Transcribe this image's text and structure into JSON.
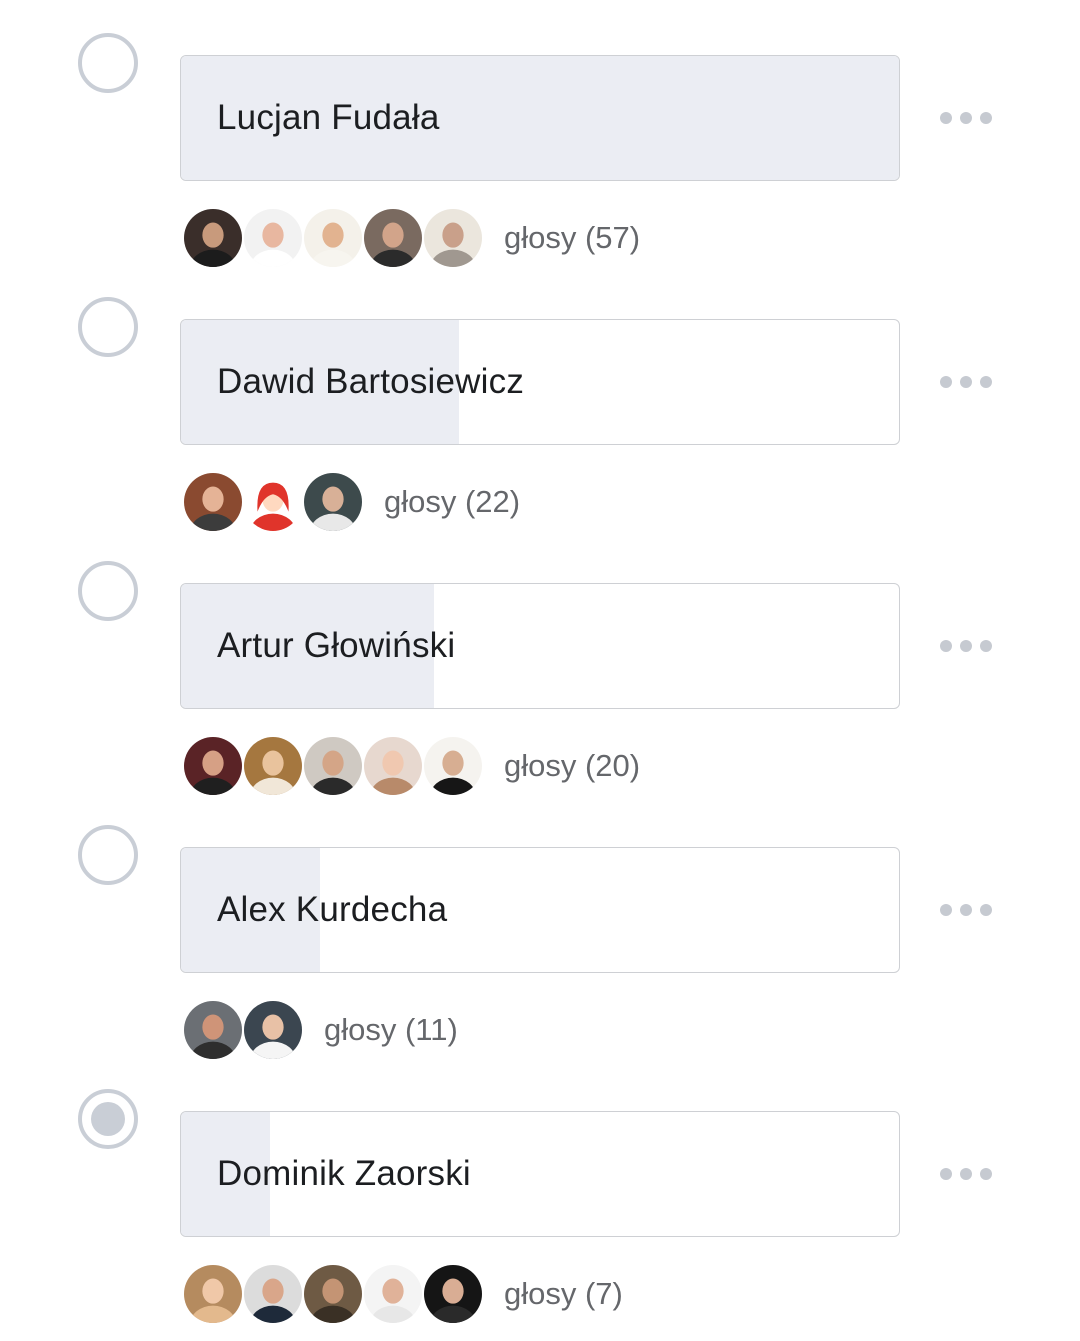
{
  "poll": {
    "options": [
      {
        "name": "Lucjan Fudała",
        "votes_label": "głosy (57)",
        "vote_share": 1.0,
        "selected": false,
        "voter_avatars": [
          {
            "icon": "profile-photo",
            "bg": "#3a2e2a",
            "face": "#c89a7c",
            "shirt": "#1c1c1c"
          },
          {
            "icon": "profile-photo",
            "bg": "#f2f2f2",
            "face": "#e8b7a0",
            "shirt": "#ffffff"
          },
          {
            "icon": "profile-photo",
            "bg": "#f4f1ea",
            "face": "#e2b390",
            "shirt": "#f7f5ef"
          },
          {
            "icon": "profile-photo",
            "bg": "#7a6a60",
            "face": "#d2a48a",
            "shirt": "#2b2b2b"
          },
          {
            "icon": "profile-photo",
            "bg": "#ebe6dd",
            "face": "#c9a08a",
            "shirt": "#a09890"
          }
        ]
      },
      {
        "name": "Dawid Bartosiewicz",
        "votes_label": "głosy (22)",
        "vote_share": 0.386,
        "selected": false,
        "voter_avatars": [
          {
            "icon": "profile-photo",
            "bg": "#8a4a30",
            "face": "#e5b396",
            "shirt": "#3c3c3c"
          },
          {
            "icon": "cartoon-avatar",
            "bg": "#ffffff",
            "face": "#ffd9c0",
            "shirt": "#e0342b"
          },
          {
            "icon": "profile-photo",
            "bg": "#3d4a4c",
            "face": "#d8b097",
            "shirt": "#e8e8e8"
          }
        ]
      },
      {
        "name": "Artur Głowiński",
        "votes_label": "głosy (20)",
        "vote_share": 0.351,
        "selected": false,
        "voter_avatars": [
          {
            "icon": "profile-photo",
            "bg": "#5a2326",
            "face": "#d6a085",
            "shirt": "#1f1f1f"
          },
          {
            "icon": "profile-photo",
            "bg": "#a5773f",
            "face": "#e9c39d",
            "shirt": "#f1e7d8"
          },
          {
            "icon": "profile-photo",
            "bg": "#cfc9c2",
            "face": "#d4a587",
            "shirt": "#2a2a2a"
          },
          {
            "icon": "profile-photo",
            "bg": "#e7d8cf",
            "face": "#f0c8b0",
            "shirt": "#b88a6a"
          },
          {
            "icon": "profile-photo",
            "bg": "#f5f3ef",
            "face": "#d7ae92",
            "shirt": "#161616"
          }
        ]
      },
      {
        "name": "Alex Kurdecha",
        "votes_label": "głosy (11)",
        "vote_share": 0.193,
        "selected": false,
        "voter_avatars": [
          {
            "icon": "profile-photo",
            "bg": "#6b6f74",
            "face": "#cf9478",
            "shirt": "#2e2e2e"
          },
          {
            "icon": "profile-photo",
            "bg": "#3b4650",
            "face": "#e8c1a6",
            "shirt": "#f5f5f5"
          }
        ]
      },
      {
        "name": "Dominik Zaorski",
        "votes_label": "głosy (7)",
        "vote_share": 0.123,
        "selected": true,
        "voter_avatars": [
          {
            "icon": "profile-photo",
            "bg": "#b58b5f",
            "face": "#f0c8a8",
            "shirt": "#e3b98d"
          },
          {
            "icon": "profile-photo",
            "bg": "#dcdcdc",
            "face": "#d9a68a",
            "shirt": "#1e2a3a"
          },
          {
            "icon": "profile-photo",
            "bg": "#6e5a44",
            "face": "#c49474",
            "shirt": "#3a3025"
          },
          {
            "icon": "profile-photo",
            "bg": "#f4f4f4",
            "face": "#e0b299",
            "shirt": "#e7e7e7"
          },
          {
            "icon": "profile-photo",
            "bg": "#151515",
            "face": "#d9ad94",
            "shirt": "#2a2a2a"
          }
        ]
      }
    ],
    "colors": {
      "bar_fill": "#ebedf3",
      "bar_border": "#ced0d4",
      "radio": "#c9ced6",
      "name_text": "#1c1e21",
      "votes_text": "#65676b",
      "more_dots": "#c6cad1"
    },
    "icons": {
      "more": "more-options-icon",
      "radio": "radio-button-icon"
    }
  }
}
